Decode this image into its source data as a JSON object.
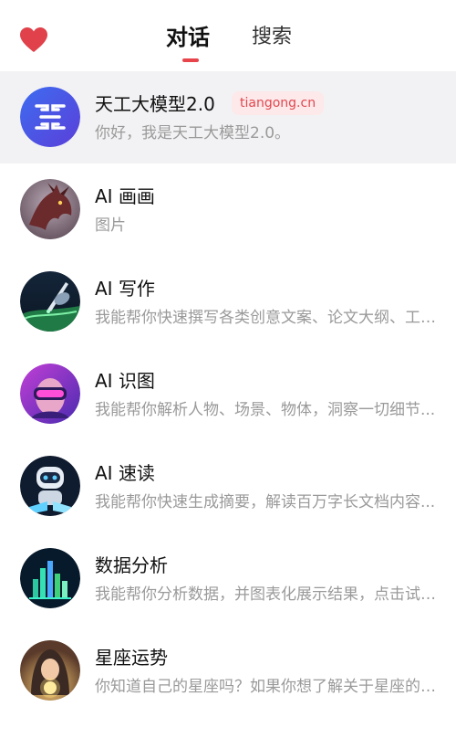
{
  "header": {
    "favorites_icon": "heart-icon",
    "tabs": [
      {
        "label": "对话",
        "active": true
      },
      {
        "label": "搜索",
        "active": false
      }
    ]
  },
  "colors": {
    "accent": "#e8444b",
    "badge_bg": "#fde8ea",
    "active_row_bg": "#f2f2f4"
  },
  "items": [
    {
      "title": "天工大模型2.0",
      "badge": "tiangong.cn",
      "subtitle": "你好，我是天工大模型2.0。",
      "icon": "tiangong-logo"
    },
    {
      "title": "AI 画画",
      "subtitle": "图片",
      "icon": "dragon-artwork"
    },
    {
      "title": "AI 写作",
      "subtitle": "我能帮你快速撰写各类创意文案、论文大纲、工作总结...",
      "icon": "pen-hand"
    },
    {
      "title": "AI 识图",
      "subtitle": "我能帮你解析人物、场景、物体，洞察一切细节...",
      "icon": "vr-headset-person"
    },
    {
      "title": "AI 速读",
      "subtitle": "我能帮你快速生成摘要，解读百万字长文档内容...",
      "icon": "robot-reading"
    },
    {
      "title": "数据分析",
      "subtitle": "我能帮你分析数据，并图表化展示结果，点击试试...",
      "icon": "bar-chart"
    },
    {
      "title": "星座运势",
      "subtitle": "你知道自己的星座吗？如果你想了解关于星座的运势...",
      "icon": "hooded-girl-orb"
    }
  ]
}
